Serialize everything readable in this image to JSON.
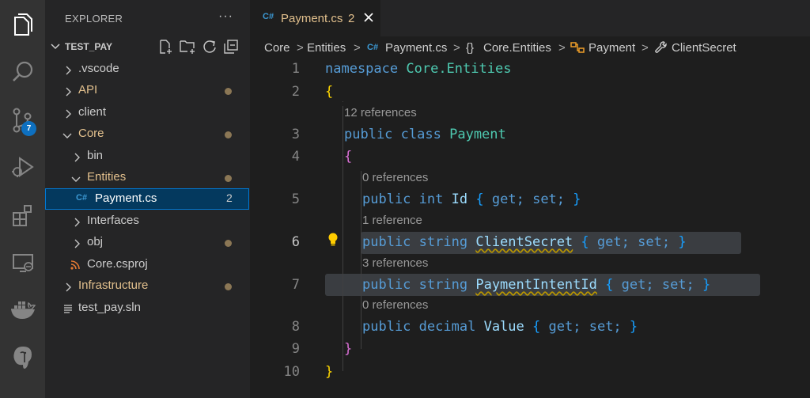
{
  "activity_bar": {
    "items": [
      {
        "name": "explorer-icon"
      },
      {
        "name": "search-icon"
      },
      {
        "name": "source-control-icon",
        "badge": "7"
      },
      {
        "name": "run-debug-icon"
      },
      {
        "name": "extensions-icon"
      },
      {
        "name": "remote-explorer-icon"
      },
      {
        "name": "docker-icon"
      },
      {
        "name": "postgresql-icon"
      }
    ]
  },
  "sidebar": {
    "title": "EXPLORER",
    "more": "···",
    "section": "TEST_PAY",
    "tree": [
      {
        "label": "vscode_dir",
        "text": ".vscode",
        "color": "#cccccc"
      },
      {
        "label": "api_dir",
        "text": "API",
        "color": "#e2c08d"
      },
      {
        "label": "client_dir",
        "text": "client",
        "color": "#cccccc"
      },
      {
        "label": "core_dir",
        "text": "Core",
        "color": "#e2c08d"
      },
      {
        "label": "bin_dir",
        "text": "bin",
        "color": "#cccccc"
      },
      {
        "label": "entities_dir",
        "text": "Entities",
        "color": "#e2c08d"
      },
      {
        "label": "payment_file",
        "text": "Payment.cs",
        "count": "2",
        "color": "#e2c08d"
      },
      {
        "label": "interfaces_dir",
        "text": "Interfaces",
        "color": "#cccccc"
      },
      {
        "label": "obj_dir",
        "text": "obj",
        "color": "#cccccc"
      },
      {
        "label": "csproj_file",
        "text": "Core.csproj",
        "color": "#cccccc"
      },
      {
        "label": "infrastructure_dir",
        "text": "Infrastructure",
        "color": "#e2c08d"
      },
      {
        "label": "sln_file",
        "text": "test_pay.sln",
        "color": "#cccccc"
      }
    ]
  },
  "tab": {
    "icon": "C#",
    "name": "Payment.cs",
    "count": "2"
  },
  "breadcrumb": {
    "b1": "Core",
    "b2": "Entities",
    "b3_icon": "C#",
    "b3": "Payment.cs",
    "b4_icon": "{}",
    "b4": "Core.Entities",
    "b5": "Payment",
    "b6": "ClientSecret",
    "sep": ">"
  },
  "editor": {
    "line_numbers": [
      "1",
      "2",
      "3",
      "4",
      "5",
      "6",
      "7",
      "8",
      "9",
      "10"
    ],
    "lens": [
      "12 references",
      "0 references",
      "1 reference",
      "3 references",
      "0 references"
    ],
    "code": {
      "namespace_kw": "namespace",
      "namespace_name": "Core.Entities",
      "open_brace": "{",
      "close_brace": "}",
      "public": "public",
      "class": "class",
      "class_name": "Payment",
      "int": "int",
      "string": "string",
      "decimal": "decimal",
      "get": "get;",
      "set": "set;",
      "prop_id": "Id",
      "prop_clientsecret": "ClientSecret",
      "prop_paymentintentid": "PaymentIntentId",
      "prop_value": "Value"
    }
  }
}
